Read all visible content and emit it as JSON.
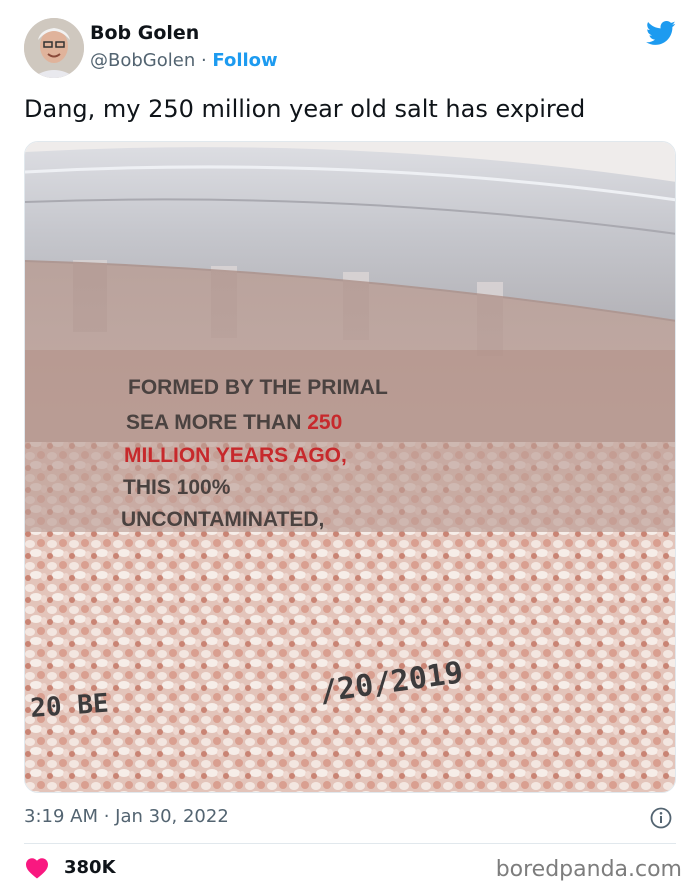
{
  "tweet": {
    "author_name": "Bob Golen",
    "author_handle": "@BobGolen",
    "separator": " · ",
    "follow_label": "Follow",
    "text": "Dang, my 250 million year old salt has expired",
    "timestamp": "3:19 AM · Jan 30, 2022",
    "likes_count": "380K"
  },
  "photo": {
    "label_lines": [
      "FORMED BY THE PRIMAL",
      "SEA MORE THAN ",
      "250",
      "MILLION YEARS AGO,",
      "THIS 100%",
      "UNCONTAMINATED,"
    ],
    "date_stamp": "/20/2019",
    "bb_stamp": "20 BE"
  },
  "watermark": "boredpanda.com",
  "colors": {
    "accent": "#1d9bf0",
    "heart": "#f91880",
    "label_red": "#c7292c"
  },
  "icons": {
    "brand": "twitter-bird-icon",
    "info": "info-icon",
    "like": "heart-icon"
  }
}
